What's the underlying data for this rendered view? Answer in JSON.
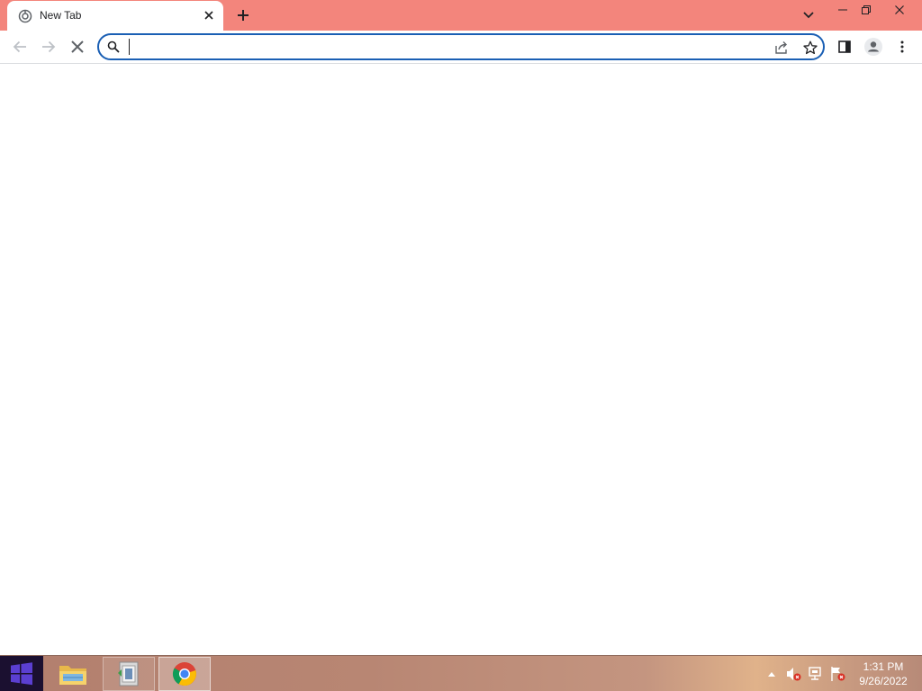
{
  "browser": {
    "tab": {
      "title": "New Tab",
      "favicon": "chrome-favicon-icon"
    },
    "omnibox": {
      "value": "",
      "placeholder": ""
    }
  },
  "taskbar": {
    "items": [
      {
        "name": "file-explorer",
        "icon": "folder-icon"
      },
      {
        "name": "app",
        "icon": "app-icon"
      },
      {
        "name": "chrome",
        "icon": "chrome-icon",
        "active": true
      }
    ],
    "clock": {
      "time": "1:31 PM",
      "date": "9/26/2022"
    }
  },
  "colors": {
    "titlebar": "#f3857c",
    "omnibox_focus": "#1a5fb4",
    "start_button": "#1b1030",
    "windows_logo": "#5b3fd1"
  }
}
